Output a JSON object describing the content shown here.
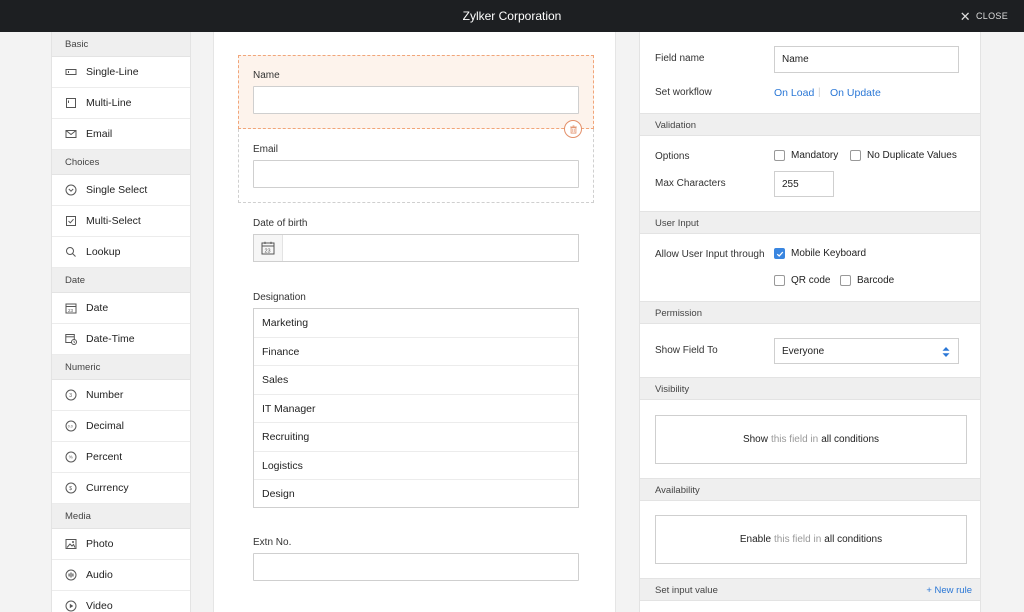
{
  "window": {
    "title": "Zylker Corporation",
    "close_label": "CLOSE"
  },
  "palette": {
    "groups": [
      {
        "heading": "Basic",
        "items": [
          {
            "label": "Single-Line",
            "icon": "single-line-icon"
          },
          {
            "label": "Multi-Line",
            "icon": "multi-line-icon"
          },
          {
            "label": "Email",
            "icon": "envelope-icon"
          }
        ]
      },
      {
        "heading": "Choices",
        "items": [
          {
            "label": "Single Select",
            "icon": "chevron-circle-icon"
          },
          {
            "label": "Multi-Select",
            "icon": "checkbox-icon"
          },
          {
            "label": "Lookup",
            "icon": "magnifier-icon"
          }
        ]
      },
      {
        "heading": "Date",
        "items": [
          {
            "label": "Date",
            "icon": "calendar-icon"
          },
          {
            "label": "Date-Time",
            "icon": "calendar-clock-icon"
          }
        ]
      },
      {
        "heading": "Numeric",
        "items": [
          {
            "label": "Number",
            "icon": "number-circle-icon"
          },
          {
            "label": "Decimal",
            "icon": "decimal-circle-icon"
          },
          {
            "label": "Percent",
            "icon": "percent-circle-icon"
          },
          {
            "label": "Currency",
            "icon": "currency-circle-icon"
          }
        ]
      },
      {
        "heading": "Media",
        "items": [
          {
            "label": "Photo",
            "icon": "photo-icon"
          },
          {
            "label": "Audio",
            "icon": "audio-icon"
          },
          {
            "label": "Video",
            "icon": "video-icon"
          }
        ]
      }
    ]
  },
  "form": {
    "name_label": "Name",
    "email_label": "Email",
    "dob_label": "Date of birth",
    "calendar_day": "23",
    "designation_label": "Designation",
    "designation_options": [
      "Marketing",
      "Finance",
      "Sales",
      "IT Manager",
      "Recruiting",
      "Logistics",
      "Design"
    ],
    "extn_label": "Extn No."
  },
  "properties": {
    "field_name_label": "Field name",
    "field_name_value": "Name",
    "workflow_label": "Set workflow",
    "workflow_on_load": "On Load",
    "workflow_separator": "|",
    "workflow_on_update": "On Update",
    "validation_heading": "Validation",
    "options_label": "Options",
    "mandatory_label": "Mandatory",
    "no_duplicate_label": "No Duplicate Values",
    "max_chars_label": "Max Characters",
    "max_chars_value": "255",
    "user_input_heading": "User Input",
    "allow_input_label": "Allow User Input through",
    "mobile_keyboard_label": "Mobile Keyboard",
    "mobile_keyboard_checked": true,
    "qr_label": "QR code",
    "barcode_label": "Barcode",
    "permission_heading": "Permission",
    "show_field_label": "Show Field To",
    "show_field_value": "Everyone",
    "visibility_heading": "Visibility",
    "visibility_show": "Show",
    "visibility_mid": "this field in",
    "visibility_end": "all conditions",
    "availability_heading": "Availability",
    "availability_enable": "Enable",
    "availability_mid": "this field in",
    "availability_end": "all conditions",
    "set_input_heading": "Set input value",
    "new_rule_label": "+ New rule"
  },
  "colors": {
    "accent": "#2a77d6",
    "selected_border": "#f1a579",
    "selected_bg": "#fdf3ec",
    "topbar": "#1d1f22",
    "checkbox": "#3a86e0"
  }
}
